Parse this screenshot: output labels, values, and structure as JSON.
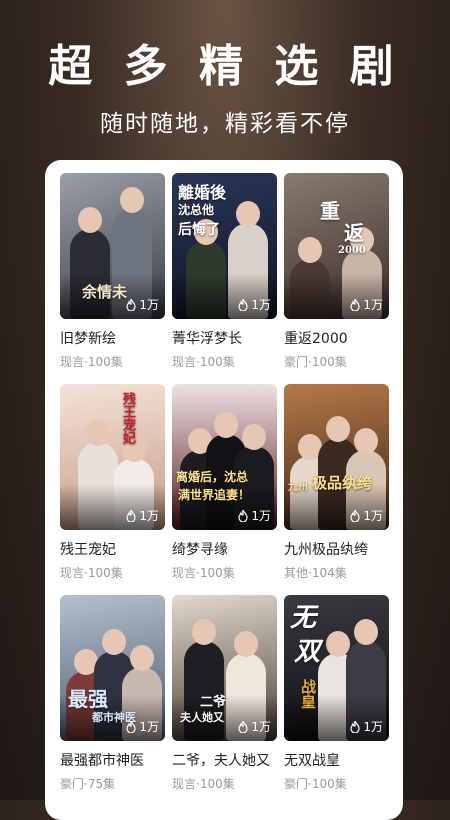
{
  "header": {
    "headline": "超 多 精 选 剧",
    "subline": "随时随地，精彩看不停"
  },
  "dramas": [
    {
      "title": "旧梦新绘",
      "genre": "现言",
      "episodes": "100集",
      "views": "1万",
      "poster_text": [
        "余情未"
      ],
      "colors": [
        "#8a8f96",
        "#3a3d44"
      ]
    },
    {
      "title": "菁华浮梦长",
      "genre": "现言",
      "episodes": "100集",
      "views": "1万",
      "poster_text": [
        "離婚後",
        "沈总他",
        "后悔了"
      ],
      "colors": [
        "#1f2a44",
        "#0e1526"
      ]
    },
    {
      "title": "重返2000",
      "genre": "豪门",
      "episodes": "100集",
      "views": "1万",
      "poster_text": [
        "重",
        "返",
        "2000"
      ],
      "colors": [
        "#7a6a60",
        "#3b2f2a"
      ]
    },
    {
      "title": "残王宠妃",
      "genre": "现言",
      "episodes": "100集",
      "views": "1万",
      "poster_text": [
        "残王宠妃"
      ],
      "colors": [
        "#f0d9cf",
        "#c79c86"
      ]
    },
    {
      "title": "绮梦寻缘",
      "genre": "现言",
      "episodes": "100集",
      "views": "1万",
      "poster_text": [
        "离婚后，沈总",
        "满世界追妻！"
      ],
      "colors": [
        "#e9dada",
        "#5c1d22"
      ]
    },
    {
      "title": "九州极品纨绔",
      "genre": "其他",
      "episodes": "104集",
      "views": "1万",
      "poster_text": [
        "九州",
        "极品纨绔"
      ],
      "colors": [
        "#a36b3c",
        "#3d2414"
      ]
    },
    {
      "title": "最强都市神医",
      "genre": "豪门",
      "episodes": "75集",
      "views": "1万",
      "poster_text": [
        "最强",
        "都市神医"
      ],
      "colors": [
        "#9fb0c2",
        "#4c5a6b"
      ]
    },
    {
      "title": "二爷，夫人她又",
      "genre": "现言",
      "episodes": "100集",
      "views": "1万",
      "poster_text": [
        "二爷",
        "夫人她又"
      ],
      "colors": [
        "#d8cfc4",
        "#4a3f36"
      ]
    },
    {
      "title": "无双战皇",
      "genre": "豪门",
      "episodes": "100集",
      "views": "1万",
      "poster_text": [
        "无",
        "双",
        "战皇"
      ],
      "colors": [
        "#2a2a2e",
        "#0d0d10"
      ]
    }
  ]
}
